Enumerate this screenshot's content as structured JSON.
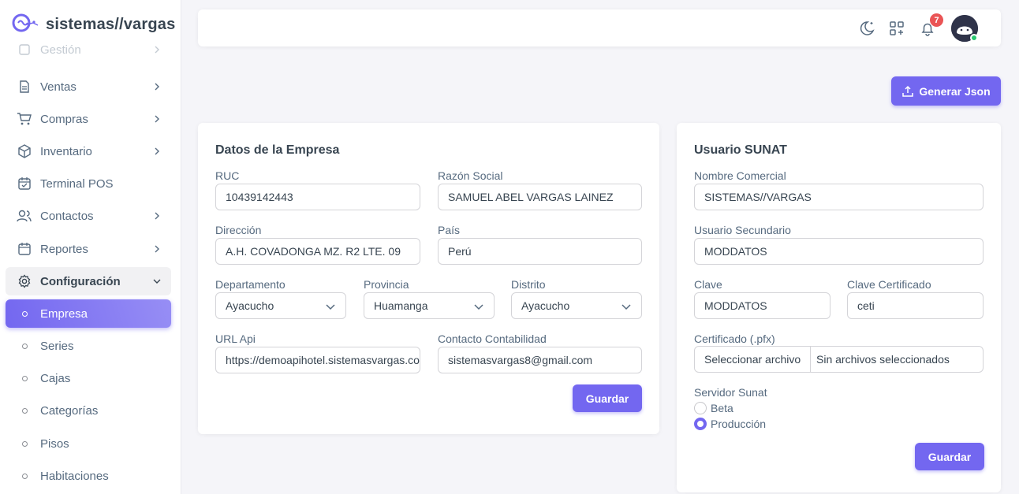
{
  "brand": {
    "name": "sistemas//vargas"
  },
  "sidebar": {
    "items": [
      {
        "label": "Gestión",
        "icon": "file-icon"
      },
      {
        "label": "Ventas",
        "icon": "file-text-icon"
      },
      {
        "label": "Compras",
        "icon": "shopping-cart-icon"
      },
      {
        "label": "Inventario",
        "icon": "box-icon"
      },
      {
        "label": "Terminal POS",
        "icon": "calendar-check-icon"
      },
      {
        "label": "Contactos",
        "icon": "users-icon"
      },
      {
        "label": "Reportes",
        "icon": "calendar-icon"
      },
      {
        "label": "Configuración",
        "icon": "gear-icon"
      }
    ],
    "sub_items": [
      {
        "label": "Empresa"
      },
      {
        "label": "Series"
      },
      {
        "label": "Cajas"
      },
      {
        "label": "Categorías"
      },
      {
        "label": "Pisos"
      },
      {
        "label": "Habitaciones"
      }
    ]
  },
  "navbar": {
    "notification_count": "7"
  },
  "actions": {
    "generate_json_label": "Generar Json"
  },
  "company_card": {
    "title": "Datos de la Empresa",
    "ruc_label": "RUC",
    "ruc_value": "10439142443",
    "razon_label": "Razón Social",
    "razon_value": "SAMUEL ABEL VARGAS LAINEZ",
    "direccion_label": "Dirección",
    "direccion_value": "A.H. COVADONGA MZ. R2 LTE. 09",
    "pais_label": "País",
    "pais_value": "Perú",
    "departamento_label": "Departamento",
    "departamento_value": "Ayacucho",
    "provincia_label": "Provincia",
    "provincia_value": "Huamanga",
    "distrito_label": "Distrito",
    "distrito_value": "Ayacucho",
    "url_label": "URL Api",
    "url_value": "https://demoapihotel.sistemasvargas.com",
    "contacto_label": "Contacto Contabilidad",
    "contacto_value": "sistemasvargas8@gmail.com",
    "save_label": "Guardar"
  },
  "sunat_card": {
    "title": "Usuario SUNAT",
    "nombre_label": "Nombre Comercial",
    "nombre_value": "SISTEMAS//VARGAS",
    "usuario_label": "Usuario Secundario",
    "usuario_value": "MODDATOS",
    "clave_label": "Clave",
    "clave_value": "MODDATOS",
    "clave_cert_label": "Clave Certificado",
    "clave_cert_value": "ceti",
    "cert_label": "Certificado (.pfx)",
    "cert_button": "Seleccionar archivo",
    "cert_status": "Sin archivos seleccionados",
    "server_label": "Servidor Sunat",
    "server_options": [
      {
        "label": "Beta",
        "checked": false
      },
      {
        "label": "Producción",
        "checked": true
      }
    ],
    "save_label": "Guardar"
  },
  "colors": {
    "primary": "#7367f0",
    "danger": "#ea5455",
    "success": "#28c76f"
  }
}
